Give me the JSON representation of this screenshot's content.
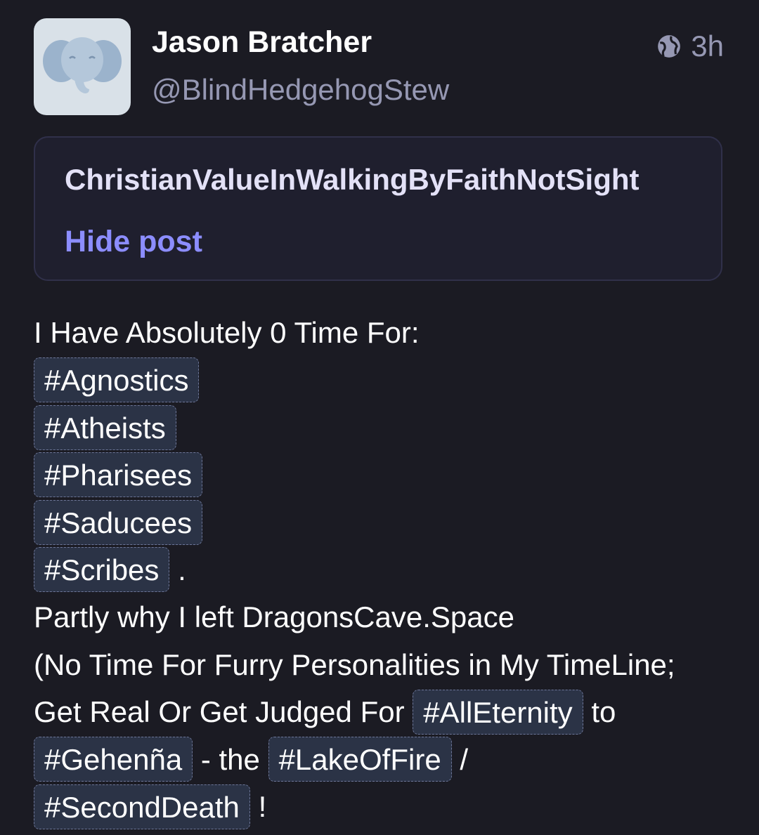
{
  "author": {
    "display_name": "Jason Bratcher",
    "handle": "@BlindHedgehogStew",
    "avatar_icon": "elephant-mastodon-default-avatar"
  },
  "meta": {
    "visibility_icon": "globe-icon",
    "timestamp": "3h"
  },
  "content_warning": {
    "text": "ChristianValueInWalkingByFaithNotSight",
    "toggle_label": "Hide post"
  },
  "body": {
    "intro": "I Have Absolutely 0 Time For:",
    "tags_list": [
      "#Agnostics",
      "#Atheists",
      "#Pharisees",
      "#Saducees",
      "#Scribes"
    ],
    "after_scribes": ".",
    "line2": "Partly why I left DragonsCave.Space",
    "line3": "(No Time For Furry Personalities in My TimeLine;",
    "line4_text": "Get Real Or Get Judged For",
    "line4_tag": "#AllEternity",
    "line4_after": "to",
    "line5_tag1": "#Gehenña",
    "line5_mid": "- the",
    "line5_tag2": "#LakeOfFire",
    "line5_after": "/",
    "line6_tag": "#SecondDeath",
    "line6_after": "!"
  },
  "colors": {
    "background": "#1b1b23",
    "accent": "#8c8dff",
    "muted": "#9698b3",
    "hashtag_bg": "#2b3346"
  }
}
